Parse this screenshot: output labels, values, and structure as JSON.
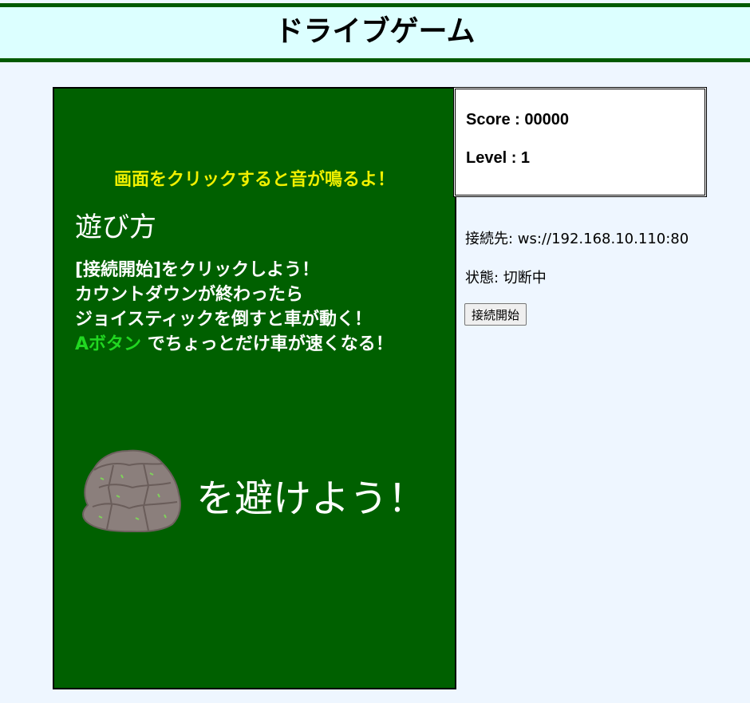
{
  "header": {
    "title": "ドライブゲーム"
  },
  "game": {
    "notice": "画面をクリックすると音が鳴るよ！",
    "howto_title": "遊び方",
    "howto_lines": [
      "[接続開始]をクリックしよう！",
      "カウントダウンが終わったら",
      "ジョイスティックを倒すと車が動く！"
    ],
    "howto_last_accent": "Aボタン",
    "howto_last_rest": " でちょっとだけ車が速くなる！",
    "avoid_text": "を避けよう！",
    "rock_icon": "rock-icon",
    "colors": {
      "background": "#006000",
      "notice": "#f0f000",
      "accent": "#21d721"
    }
  },
  "scoreboard": {
    "score": "Score : 00000",
    "level": "Level : 1"
  },
  "connection": {
    "target": "接続先: ws://192.168.10.110:80",
    "status": "状態: 切断中",
    "connect_button": "接続開始"
  },
  "colors": {
    "page_background": "#eef6ff",
    "header_background": "#dcffff",
    "header_border": "#005a00"
  }
}
